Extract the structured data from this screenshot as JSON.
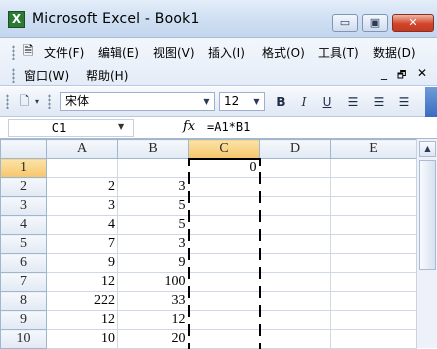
{
  "window": {
    "title": "Microsoft Excel - Book1",
    "app_icon": "X",
    "minimize": "▭",
    "restore": "▣",
    "close": "✕"
  },
  "menu": {
    "row1": [
      "文件(F)",
      "编辑(E)",
      "视图(V)",
      "插入(I)",
      "格式(O)",
      "工具(T)",
      "数据(D)"
    ],
    "row2": [
      "窗口(W)",
      "帮助(H)"
    ],
    "doc_controls": [
      "_",
      "🗗",
      "✕"
    ]
  },
  "toolbar": {
    "font_name": "宋体",
    "font_size": "12",
    "bold": "B",
    "italic": "I",
    "underline": "U",
    "icons": [
      "new-document-icon",
      "align-left-icon",
      "align-center-icon",
      "align-right-icon"
    ]
  },
  "formula_bar": {
    "name_box": "C1",
    "fx": "fx",
    "formula": "=A1*B1"
  },
  "sheet": {
    "columns": [
      "A",
      "B",
      "C",
      "D",
      "E"
    ],
    "active_column": "C",
    "active_row": "1",
    "rows": [
      {
        "num": "1",
        "A": "",
        "B": "",
        "C": "0"
      },
      {
        "num": "2",
        "A": "2",
        "B": "3",
        "C": ""
      },
      {
        "num": "3",
        "A": "3",
        "B": "5",
        "C": ""
      },
      {
        "num": "4",
        "A": "4",
        "B": "5",
        "C": ""
      },
      {
        "num": "5",
        "A": "7",
        "B": "3",
        "C": ""
      },
      {
        "num": "6",
        "A": "9",
        "B": "9",
        "C": ""
      },
      {
        "num": "7",
        "A": "12",
        "B": "100",
        "C": ""
      },
      {
        "num": "8",
        "A": "222",
        "B": "33",
        "C": ""
      },
      {
        "num": "9",
        "A": "12",
        "B": "12",
        "C": ""
      },
      {
        "num": "10",
        "A": "10",
        "B": "20",
        "C": ""
      }
    ]
  },
  "colors": {
    "title_bg": "#d2e1f3",
    "active_header": "#f6c66b",
    "grid_line": "#d0d7e5",
    "close_button": "#d1452b"
  }
}
